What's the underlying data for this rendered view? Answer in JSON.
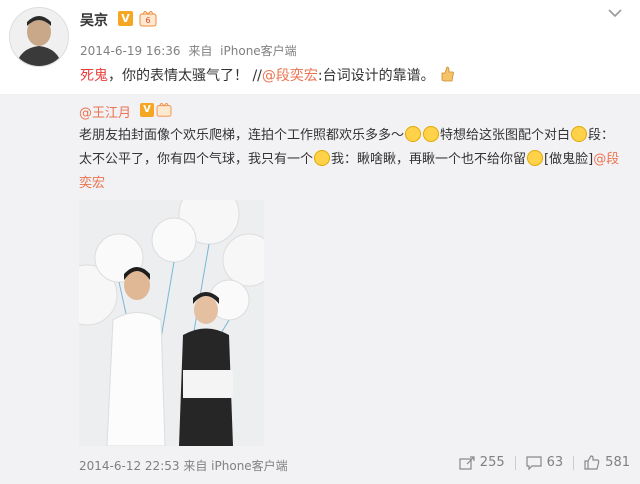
{
  "post": {
    "author": "吴京",
    "v_badge": "V",
    "timestamp": "2014-6-19 16:36",
    "source_prefix": "来自",
    "source": "iPhone客户端",
    "text_red": "死鬼",
    "text_main": "，你的表情太骚气了！ //",
    "mention": "@段奕宏",
    "text_after": ":台词设计的靠谱。"
  },
  "repost": {
    "author": "@王江月",
    "line1_a": "老朋友拍封面像个欢乐爬梯，连拍个工作照都欢乐多多～",
    "line1_b": "特想给这张图配个对白",
    "line1_c": "段：",
    "line2_a": "太不公平了，你有四个气球，我只有一个",
    "line2_b": "我：瞅啥瞅，再瞅一个也不给你留",
    "line2_c": "[做鬼脸]",
    "line2_mention": "@段",
    "line3_mention": "奕宏",
    "timestamp": "2014-6-12 22:53",
    "source_prefix": "来自",
    "source": "iPhone客户端",
    "repost_count": "255",
    "comment_count": "63",
    "like_count": "581"
  },
  "colors": {
    "link": "#eb7350",
    "red": "#eb3c3c",
    "meta": "#808080"
  }
}
